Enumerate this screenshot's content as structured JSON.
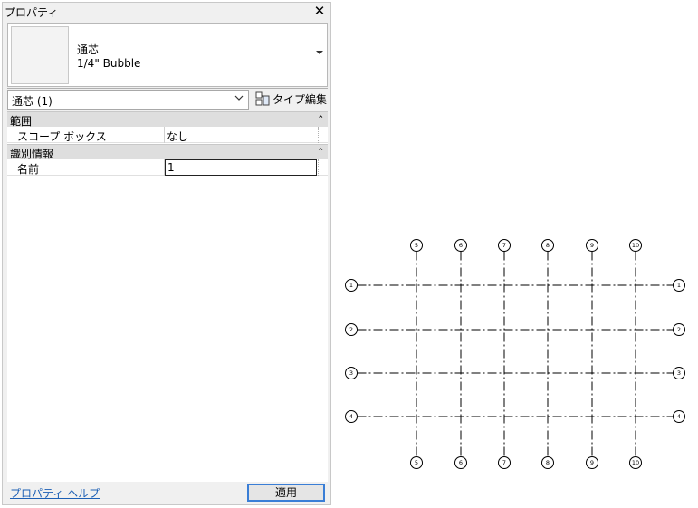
{
  "palette": {
    "title": "プロパティ",
    "type_family": "通芯",
    "type_name": "1/4\" Bubble",
    "instance_filter": "通芯 (1)",
    "edit_type_label": "タイプ編集",
    "groups": [
      {
        "label": "範囲",
        "properties": [
          {
            "name": "スコープ ボックス",
            "value": "なし"
          }
        ]
      },
      {
        "label": "識別情報",
        "properties": [
          {
            "name": "名前",
            "value": "1"
          }
        ]
      }
    ],
    "help_link": "プロパティ ヘルプ",
    "apply_label": "適用"
  },
  "drawing": {
    "vertical_grids": [
      "5",
      "6",
      "7",
      "8",
      "9",
      "10"
    ],
    "horizontal_grids": [
      "1",
      "2",
      "3",
      "4"
    ]
  }
}
